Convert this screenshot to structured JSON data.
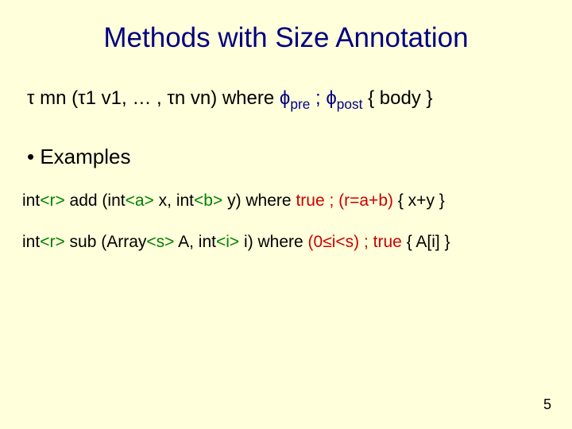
{
  "title": "Methods with Size Annotation",
  "sig": {
    "tau": "τ",
    "mn": " mn (",
    "tau1": "τ1 v1, … , τn vn",
    "close_where": ") where ",
    "phi": "ϕ",
    "pre": "pre",
    "sep": " ; ",
    "post": "post",
    "tail": " { body }"
  },
  "bullet": "• Examples",
  "ex1": {
    "a": "int",
    "r": "<r>",
    "b": " add (int",
    "aa": "<a>",
    "c": " x, int",
    "bb": "<b>",
    "d": " y) where ",
    "cond": "true ; (r=a+b)",
    "e": " { x+y }"
  },
  "ex2": {
    "a": "int",
    "r": "<r>",
    "b": " sub (Array",
    "s": "<s>",
    "c": " A, int",
    "i": "<i>",
    "d": " i) where ",
    "cond": "(0≤i<s) ; true",
    "e": " { A[i] }"
  },
  "pagenum": "5"
}
